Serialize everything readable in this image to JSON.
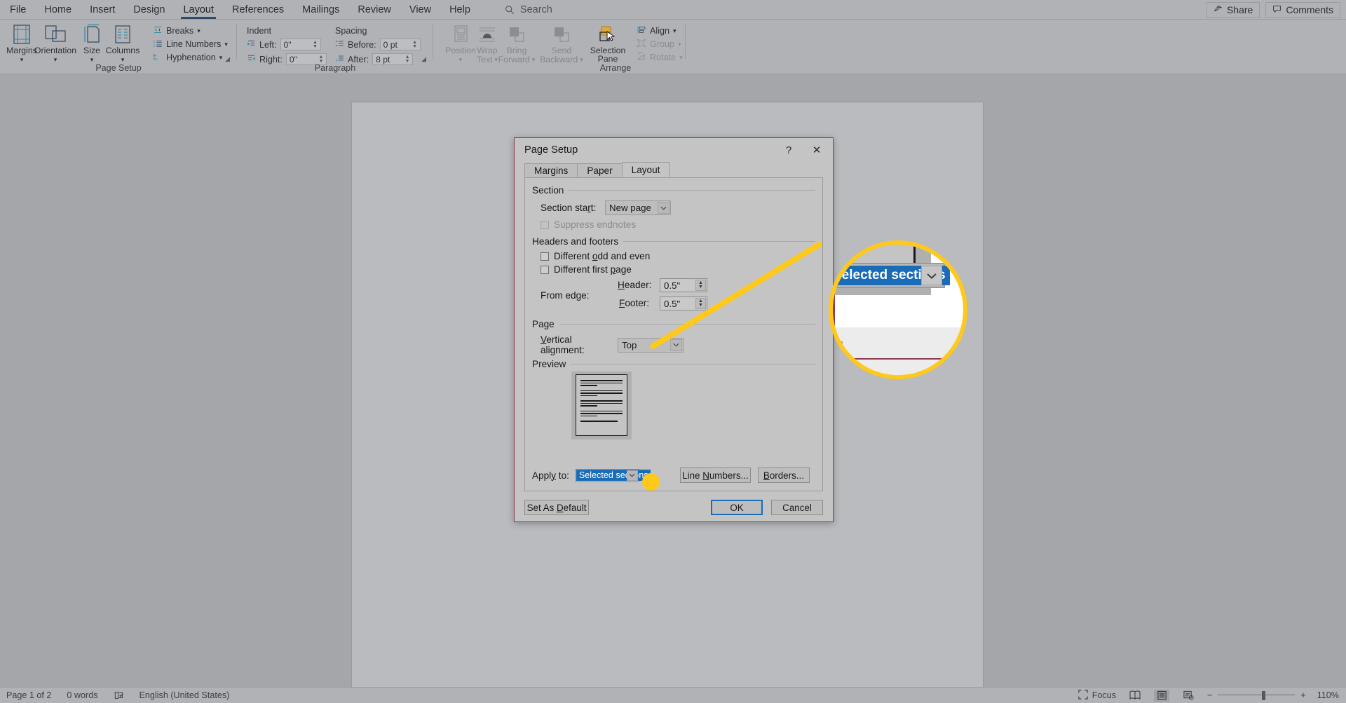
{
  "app": {
    "ribbon_tabs": [
      {
        "label": "File",
        "active": false
      },
      {
        "label": "Home",
        "active": false
      },
      {
        "label": "Insert",
        "active": false
      },
      {
        "label": "Design",
        "active": false
      },
      {
        "label": "Layout",
        "active": true
      },
      {
        "label": "References",
        "active": false
      },
      {
        "label": "Mailings",
        "active": false
      },
      {
        "label": "Review",
        "active": false
      },
      {
        "label": "View",
        "active": false
      },
      {
        "label": "Help",
        "active": false
      }
    ],
    "search": {
      "label": "Search",
      "icon": "search-icon"
    },
    "titlebar_right": [
      {
        "label": "Share",
        "icon": "share-icon"
      },
      {
        "label": "Comments",
        "icon": "comment-icon"
      }
    ]
  },
  "ribbon": {
    "page_setup": {
      "group_label": "Page Setup",
      "buttons": [
        {
          "label": "Margins",
          "icon": "margins-icon",
          "has_caret": true
        },
        {
          "label": "Orientation",
          "icon": "orientation-icon",
          "has_caret": true
        },
        {
          "label": "Size",
          "icon": "size-icon",
          "has_caret": true
        },
        {
          "label": "Columns",
          "icon": "columns-icon",
          "has_caret": true
        }
      ],
      "small_items": [
        {
          "label": "Breaks",
          "icon": "breaks-icon",
          "caret": "⌄"
        },
        {
          "label": "Line Numbers",
          "icon": "line-numbers-icon",
          "caret": "⌄"
        },
        {
          "label": "Hyphenation",
          "icon": "hyphenation-icon",
          "caret": "⌄"
        }
      ]
    },
    "paragraph": {
      "group_label": "Paragraph",
      "indent_header": "Indent",
      "spacing_header": "Spacing",
      "fields": [
        {
          "label": "Left:",
          "value": "0\"",
          "icon": "indent-left-icon"
        },
        {
          "label": "Right:",
          "value": "0\"",
          "icon": "indent-right-icon"
        },
        {
          "label": "Before:",
          "value": "0 pt",
          "icon": "spacing-before-icon"
        },
        {
          "label": "After:",
          "value": "8 pt",
          "icon": "spacing-after-icon"
        }
      ]
    },
    "arrange": {
      "group_label": "Arrange",
      "buttons": [
        {
          "label": "Position",
          "label2": "",
          "icon": "position-icon",
          "has_caret": true,
          "dim": true
        },
        {
          "label": "Wrap",
          "label2": "Text",
          "icon": "wrap-text-icon",
          "has_caret": true,
          "dim": true
        },
        {
          "label": "Bring",
          "label2": "Forward",
          "icon": "bring-forward-icon",
          "has_caret": true,
          "dim": true
        },
        {
          "label": "Send",
          "label2": "Backward",
          "icon": "send-backward-icon",
          "has_caret": true,
          "dim": true
        },
        {
          "label": "Selection",
          "label2": "Pane",
          "icon": "selection-pane-icon",
          "has_caret": false,
          "dim": false
        }
      ],
      "small_items": [
        {
          "label": "Align",
          "icon": "align-icon",
          "caret": "⌄",
          "dim": false
        },
        {
          "label": "Group",
          "icon": "group-icon",
          "caret": "⌄",
          "dim": true
        },
        {
          "label": "Rotate",
          "icon": "rotate-icon",
          "caret": "⌄",
          "dim": true
        }
      ]
    }
  },
  "dialog": {
    "title": "Page Setup",
    "help_icon": "?",
    "close_icon": "✕",
    "tabs": [
      {
        "label": "Margins",
        "active": false
      },
      {
        "label": "Paper",
        "active": false
      },
      {
        "label": "Layout",
        "active": true
      }
    ],
    "section": {
      "header": "Section",
      "section_start_label": "Section start:",
      "section_start_value": "New page",
      "suppress_endnotes_label": "Suppress endnotes",
      "suppress_endnotes_checked": false,
      "suppress_endnotes_disabled": true
    },
    "headers_footers": {
      "header": "Headers and footers",
      "different_odd_even_label": "Different odd and even",
      "different_odd_even_checked": false,
      "different_first_page_label": "Different first page",
      "different_first_page_checked": false,
      "from_edge_label": "From edge:",
      "header_label": "Header:",
      "header_value": "0.5\"",
      "footer_label": "Footer:",
      "footer_value": "0.5\""
    },
    "page": {
      "header": "Page",
      "vertical_alignment_label": "Vertical alignment:",
      "vertical_alignment_value": "Top"
    },
    "preview": {
      "header": "Preview",
      "apply_to_label": "Apply to:",
      "apply_to_value": "Selected sections",
      "line_numbers_button": "Line Numbers...",
      "borders_button": "Borders..."
    },
    "footer": {
      "set_as_default": "Set As Default",
      "ok": "OK",
      "cancel": "Cancel"
    }
  },
  "magnifier": {
    "highlighted_value": "Selected sections",
    "partial_button_text": "lt",
    "accent_color": "#ffc91b",
    "selection_color": "#1a6bb8"
  },
  "statusbar": {
    "page_info": "Page 1 of 2",
    "word_count": "0 words",
    "proofing_icon": "proofing-icon",
    "language": "English (United States)",
    "focus_label": "Focus",
    "view_buttons": [
      {
        "name": "read-mode-icon",
        "selected": false
      },
      {
        "name": "print-layout-icon",
        "selected": true
      },
      {
        "name": "web-layout-icon",
        "selected": false
      }
    ],
    "zoom_out": "−",
    "zoom_in": "+",
    "zoom_level": "110%"
  }
}
